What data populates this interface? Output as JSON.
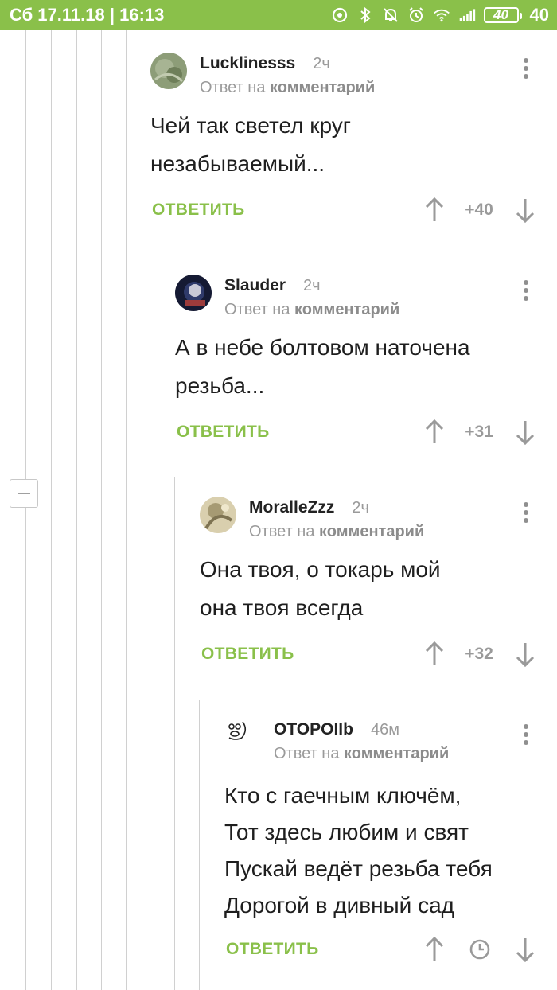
{
  "status_bar": {
    "date_time": "Сб 17.11.18 | 16:13",
    "battery_level": "40",
    "battery_text": "40",
    "icons": [
      "data-saver-icon",
      "bluetooth-icon",
      "mute-icon",
      "alarm-icon",
      "wifi-icon",
      "signal-icon",
      "battery-icon"
    ]
  },
  "comments": [
    {
      "author": "Lucklinesss",
      "time": "2ч",
      "reply_prefix": "Ответ на",
      "reply_link": "комментарий",
      "text_lines": [
        "Чей так светел круг",
        "незабываемый..."
      ],
      "reply_label": "ОТВЕТИТЬ",
      "score": "+40"
    },
    {
      "author": "Slauder",
      "time": "2ч",
      "reply_prefix": "Ответ на",
      "reply_link": "комментарий",
      "text_lines": [
        "А в небе болтовом наточена",
        "резьба..."
      ],
      "reply_label": "ОТВЕТИТЬ",
      "score": "+31"
    },
    {
      "author": "MoralleZzz",
      "time": "2ч",
      "reply_prefix": "Ответ на",
      "reply_link": "комментарий",
      "text_lines": [
        "Она твоя, о токарь мой",
        "она твоя всегда"
      ],
      "reply_label": "ОТВЕТИТЬ",
      "score": "+32"
    },
    {
      "author": "OTOPOIIb",
      "time": "46м",
      "reply_prefix": "Ответ на",
      "reply_link": "комментарий",
      "text_lines": [
        "Кто с гаечным ключём,",
        "Тот здесь любим и свят",
        "Пускай ведёт резьба тебя",
        "Дорогой в дивный сад"
      ],
      "reply_label": "ОТВЕТИТЬ",
      "score_icon": "clock-icon"
    }
  ],
  "colors": {
    "accent": "#8ac04a",
    "muted_text": "#9a9a9a",
    "thread_line": "#d0d0d0"
  }
}
